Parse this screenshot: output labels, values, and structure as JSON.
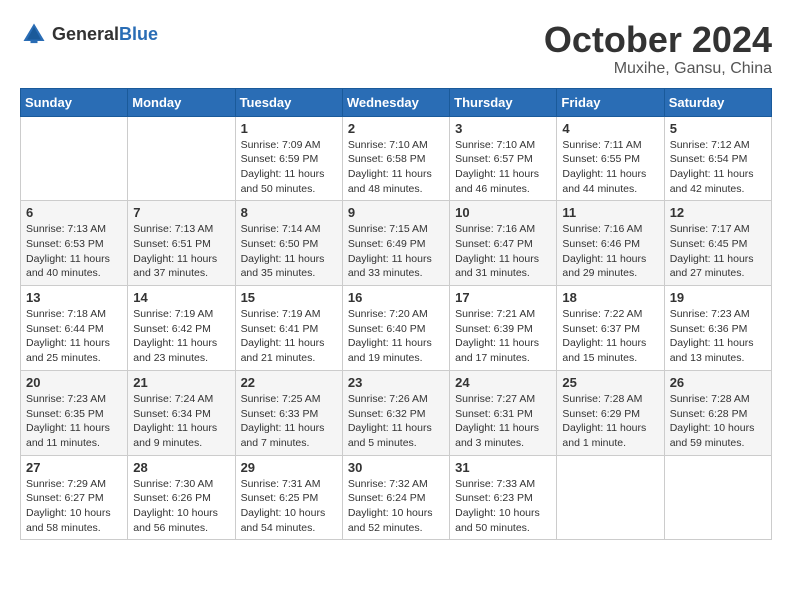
{
  "logo": {
    "general": "General",
    "blue": "Blue"
  },
  "title": "October 2024",
  "location": "Muxihe, Gansu, China",
  "days_of_week": [
    "Sunday",
    "Monday",
    "Tuesday",
    "Wednesday",
    "Thursday",
    "Friday",
    "Saturday"
  ],
  "weeks": [
    [
      {
        "day": "",
        "content": ""
      },
      {
        "day": "",
        "content": ""
      },
      {
        "day": "1",
        "content": "Sunrise: 7:09 AM\nSunset: 6:59 PM\nDaylight: 11 hours and 50 minutes."
      },
      {
        "day": "2",
        "content": "Sunrise: 7:10 AM\nSunset: 6:58 PM\nDaylight: 11 hours and 48 minutes."
      },
      {
        "day": "3",
        "content": "Sunrise: 7:10 AM\nSunset: 6:57 PM\nDaylight: 11 hours and 46 minutes."
      },
      {
        "day": "4",
        "content": "Sunrise: 7:11 AM\nSunset: 6:55 PM\nDaylight: 11 hours and 44 minutes."
      },
      {
        "day": "5",
        "content": "Sunrise: 7:12 AM\nSunset: 6:54 PM\nDaylight: 11 hours and 42 minutes."
      }
    ],
    [
      {
        "day": "6",
        "content": "Sunrise: 7:13 AM\nSunset: 6:53 PM\nDaylight: 11 hours and 40 minutes."
      },
      {
        "day": "7",
        "content": "Sunrise: 7:13 AM\nSunset: 6:51 PM\nDaylight: 11 hours and 37 minutes."
      },
      {
        "day": "8",
        "content": "Sunrise: 7:14 AM\nSunset: 6:50 PM\nDaylight: 11 hours and 35 minutes."
      },
      {
        "day": "9",
        "content": "Sunrise: 7:15 AM\nSunset: 6:49 PM\nDaylight: 11 hours and 33 minutes."
      },
      {
        "day": "10",
        "content": "Sunrise: 7:16 AM\nSunset: 6:47 PM\nDaylight: 11 hours and 31 minutes."
      },
      {
        "day": "11",
        "content": "Sunrise: 7:16 AM\nSunset: 6:46 PM\nDaylight: 11 hours and 29 minutes."
      },
      {
        "day": "12",
        "content": "Sunrise: 7:17 AM\nSunset: 6:45 PM\nDaylight: 11 hours and 27 minutes."
      }
    ],
    [
      {
        "day": "13",
        "content": "Sunrise: 7:18 AM\nSunset: 6:44 PM\nDaylight: 11 hours and 25 minutes."
      },
      {
        "day": "14",
        "content": "Sunrise: 7:19 AM\nSunset: 6:42 PM\nDaylight: 11 hours and 23 minutes."
      },
      {
        "day": "15",
        "content": "Sunrise: 7:19 AM\nSunset: 6:41 PM\nDaylight: 11 hours and 21 minutes."
      },
      {
        "day": "16",
        "content": "Sunrise: 7:20 AM\nSunset: 6:40 PM\nDaylight: 11 hours and 19 minutes."
      },
      {
        "day": "17",
        "content": "Sunrise: 7:21 AM\nSunset: 6:39 PM\nDaylight: 11 hours and 17 minutes."
      },
      {
        "day": "18",
        "content": "Sunrise: 7:22 AM\nSunset: 6:37 PM\nDaylight: 11 hours and 15 minutes."
      },
      {
        "day": "19",
        "content": "Sunrise: 7:23 AM\nSunset: 6:36 PM\nDaylight: 11 hours and 13 minutes."
      }
    ],
    [
      {
        "day": "20",
        "content": "Sunrise: 7:23 AM\nSunset: 6:35 PM\nDaylight: 11 hours and 11 minutes."
      },
      {
        "day": "21",
        "content": "Sunrise: 7:24 AM\nSunset: 6:34 PM\nDaylight: 11 hours and 9 minutes."
      },
      {
        "day": "22",
        "content": "Sunrise: 7:25 AM\nSunset: 6:33 PM\nDaylight: 11 hours and 7 minutes."
      },
      {
        "day": "23",
        "content": "Sunrise: 7:26 AM\nSunset: 6:32 PM\nDaylight: 11 hours and 5 minutes."
      },
      {
        "day": "24",
        "content": "Sunrise: 7:27 AM\nSunset: 6:31 PM\nDaylight: 11 hours and 3 minutes."
      },
      {
        "day": "25",
        "content": "Sunrise: 7:28 AM\nSunset: 6:29 PM\nDaylight: 11 hours and 1 minute."
      },
      {
        "day": "26",
        "content": "Sunrise: 7:28 AM\nSunset: 6:28 PM\nDaylight: 10 hours and 59 minutes."
      }
    ],
    [
      {
        "day": "27",
        "content": "Sunrise: 7:29 AM\nSunset: 6:27 PM\nDaylight: 10 hours and 58 minutes."
      },
      {
        "day": "28",
        "content": "Sunrise: 7:30 AM\nSunset: 6:26 PM\nDaylight: 10 hours and 56 minutes."
      },
      {
        "day": "29",
        "content": "Sunrise: 7:31 AM\nSunset: 6:25 PM\nDaylight: 10 hours and 54 minutes."
      },
      {
        "day": "30",
        "content": "Sunrise: 7:32 AM\nSunset: 6:24 PM\nDaylight: 10 hours and 52 minutes."
      },
      {
        "day": "31",
        "content": "Sunrise: 7:33 AM\nSunset: 6:23 PM\nDaylight: 10 hours and 50 minutes."
      },
      {
        "day": "",
        "content": ""
      },
      {
        "day": "",
        "content": ""
      }
    ]
  ]
}
